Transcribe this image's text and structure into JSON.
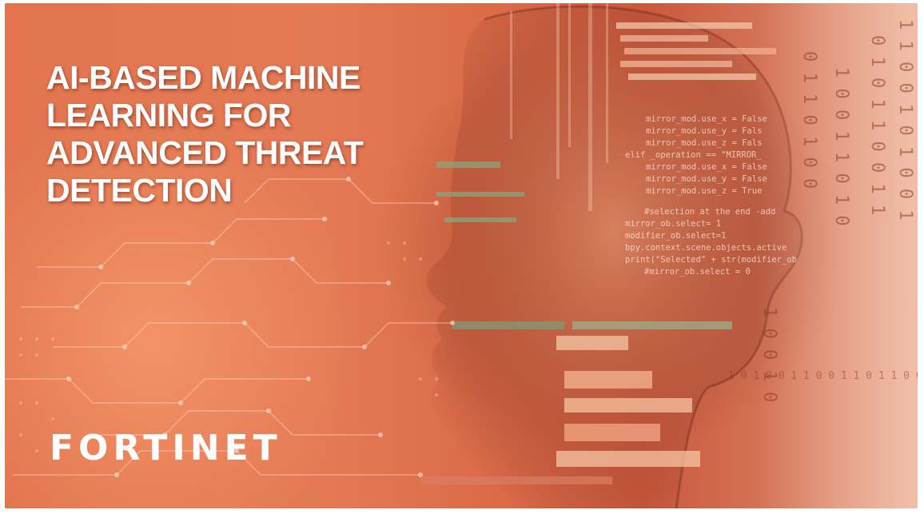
{
  "headline": {
    "lines": [
      "AI-BASED MACHINE",
      "LEARNING FOR",
      "ADVANCED THREAT",
      "DETECTION"
    ]
  },
  "brand": {
    "logo_text": "FORTINET",
    "logo_color": "#ffffff"
  },
  "background": {
    "accent": "#e2754f",
    "shadow": "#7a2a18",
    "code_snippet": [
      "mirror_mod.use_x = False",
      "mirror_mod.use_y = Fals",
      "mirror_mod.use_z = Fals",
      "elif _operation == \"MIRROR_",
      "mirror_mod.use_x = False",
      "mirror_mod.use_y = False",
      "mirror_mod.use_z = True",
      "#selection at the end -add",
      "mirror_ob.select= 1",
      "modifier_ob.select=1",
      "bpy.context.scene.objects.active",
      "print(\"Selected\" + str(modifier_ob",
      "#mirror_ob.select = 0"
    ],
    "binary_digits": "1 0 1 0 0 1 1 0 0 1 1 0 1 1 0 0 0 1 0 1 1 0"
  }
}
